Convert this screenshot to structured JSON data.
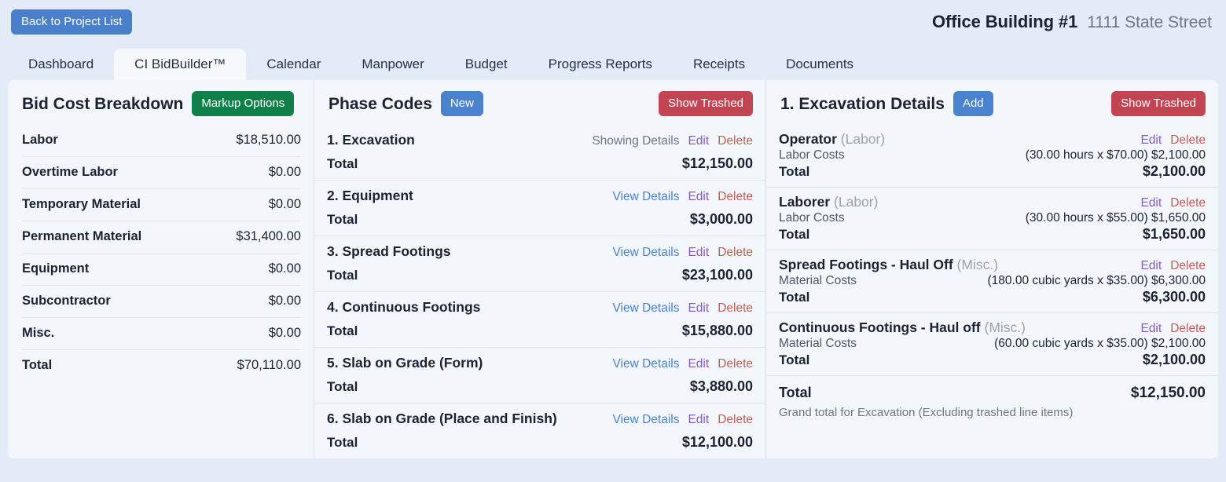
{
  "header": {
    "back_button": "Back to Project List",
    "project_name": "Office Building #1",
    "project_address": "1111 State Street"
  },
  "tabs": [
    {
      "label": "Dashboard",
      "active": false
    },
    {
      "label": "CI BidBuilder™",
      "active": true
    },
    {
      "label": "Calendar",
      "active": false
    },
    {
      "label": "Manpower",
      "active": false
    },
    {
      "label": "Budget",
      "active": false
    },
    {
      "label": "Progress Reports",
      "active": false
    },
    {
      "label": "Receipts",
      "active": false
    },
    {
      "label": "Documents",
      "active": false
    }
  ],
  "left_panel": {
    "title": "Bid Cost Breakdown",
    "markup_button": "Markup Options",
    "rows": [
      {
        "label": "Labor",
        "value": "$18,510.00"
      },
      {
        "label": "Overtime Labor",
        "value": "$0.00"
      },
      {
        "label": "Temporary Material",
        "value": "$0.00"
      },
      {
        "label": "Permanent Material",
        "value": "$31,400.00"
      },
      {
        "label": "Equipment",
        "value": "$0.00"
      },
      {
        "label": "Subcontractor",
        "value": "$0.00"
      },
      {
        "label": "Misc.",
        "value": "$0.00"
      },
      {
        "label": "Total",
        "value": "$70,110.00"
      }
    ]
  },
  "middle_panel": {
    "title": "Phase Codes",
    "new_button": "New",
    "show_trashed_button": "Show Trashed",
    "total_label": "Total",
    "details_showing_label": "Showing Details",
    "details_view_label": "View Details",
    "edit_label": "Edit",
    "delete_label": "Delete",
    "phases": [
      {
        "name": "1. Excavation",
        "details_label": "Showing Details",
        "details_state": "showing",
        "total": "$12,150.00"
      },
      {
        "name": "2. Equipment",
        "details_label": "View Details",
        "details_state": "view",
        "total": "$3,000.00"
      },
      {
        "name": "3. Spread Footings",
        "details_label": "View Details",
        "details_state": "view",
        "total": "$23,100.00"
      },
      {
        "name": "4. Continuous Footings",
        "details_label": "View Details",
        "details_state": "view",
        "total": "$15,880.00"
      },
      {
        "name": "5. Slab on Grade (Form)",
        "details_label": "View Details",
        "details_state": "view",
        "total": "$3,880.00"
      },
      {
        "name": "6. Slab on Grade (Place and Finish)",
        "details_label": "View Details",
        "details_state": "view",
        "total": "$12,100.00"
      }
    ]
  },
  "right_panel": {
    "title": "1. Excavation Details",
    "add_button": "Add",
    "show_trashed_button": "Show Trashed",
    "edit_label": "Edit",
    "delete_label": "Delete",
    "total_label": "Total",
    "items": [
      {
        "name": "Operator",
        "kind": "(Labor)",
        "cost_type": "Labor Costs",
        "calc": "(30.00 hours x $70.00)",
        "amount": "$2,100.00",
        "total_label": "Total",
        "total": "$2,100.00"
      },
      {
        "name": "Laborer",
        "kind": "(Labor)",
        "cost_type": "Labor Costs",
        "calc": "(30.00 hours x $55.00)",
        "amount": "$1,650.00",
        "total_label": "Total",
        "total": "$1,650.00"
      },
      {
        "name": "Spread Footings - Haul Off",
        "kind": "(Misc.)",
        "cost_type": "Material Costs",
        "calc": "(180.00 cubic yards x $35.00)",
        "amount": "$6,300.00",
        "total_label": "Total",
        "total": "$6,300.00"
      },
      {
        "name": "Continuous Footings - Haul off",
        "kind": "(Misc.)",
        "cost_type": "Material Costs",
        "calc": "(60.00 cubic yards x $35.00)",
        "amount": "$2,100.00",
        "total_label": "Total",
        "total": "$2,100.00"
      }
    ],
    "grand_total_label": "Total",
    "grand_total_value": "$12,150.00",
    "grand_total_note": "Grand total for Excavation (Excluding trashed line items)"
  },
  "colors": {
    "page_background": "#e2ebf7",
    "panel_background": "#f3f7fb",
    "primary_blue": "#4a82cd",
    "danger_red": "#c14552",
    "success_green": "#10804a",
    "link_blue": "#4a82cd",
    "link_visited_purple": "#8a5bbd",
    "link_delete_red": "#bb6055"
  }
}
